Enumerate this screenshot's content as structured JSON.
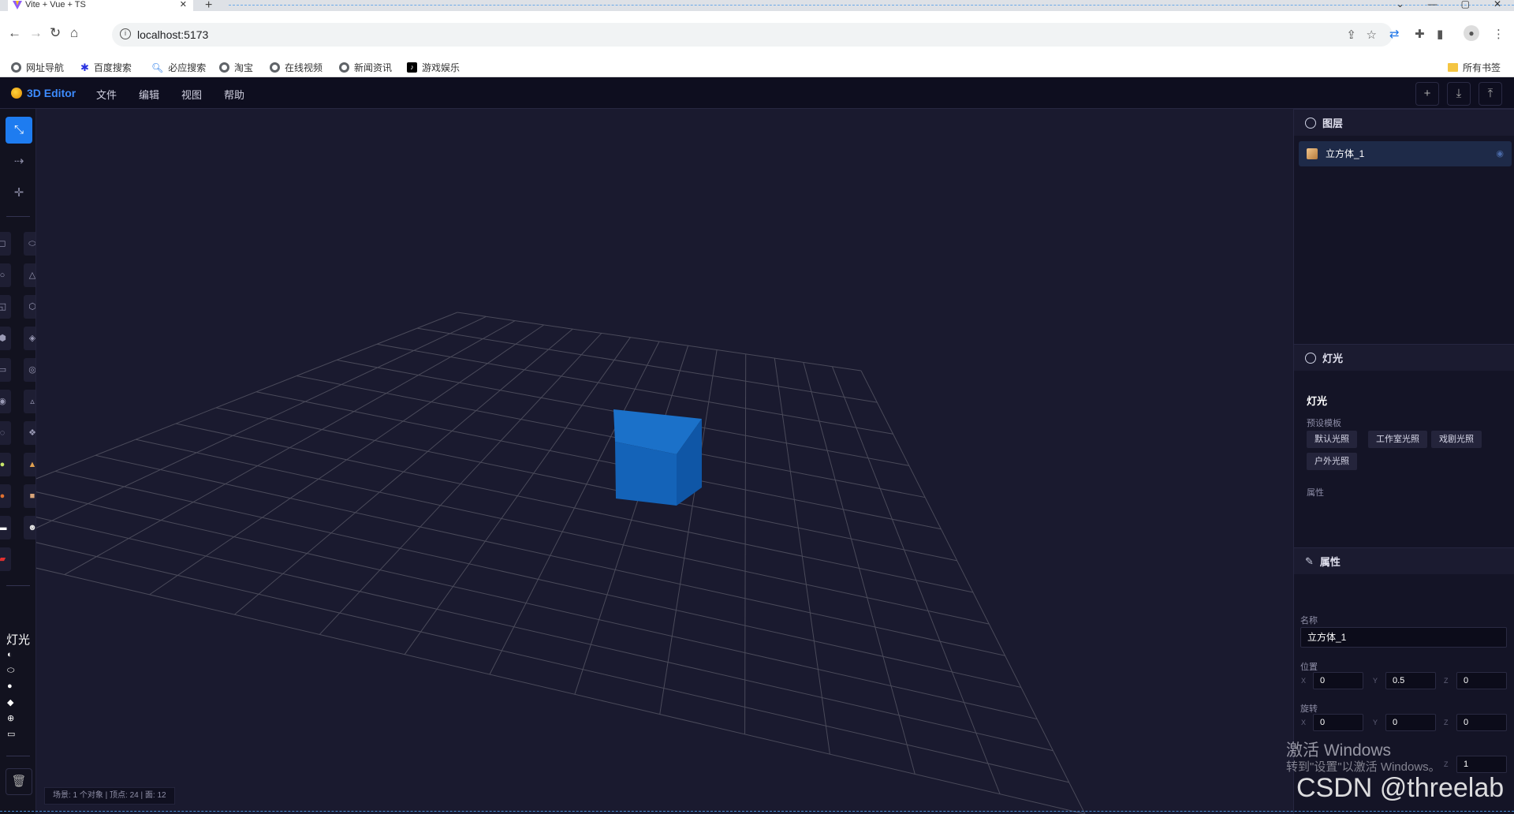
{
  "browser": {
    "tab_title": "Vite + Vue + TS",
    "url": "localhost:5173",
    "bookmarks": [
      "网址导航",
      "百度搜索",
      "必应搜索",
      "淘宝",
      "在线视频",
      "新闻资讯",
      "游戏娱乐"
    ],
    "all_bookmarks": "所有书签"
  },
  "app": {
    "brand": "3D Editor",
    "menus": [
      "文件",
      "编辑",
      "视图",
      "帮助"
    ]
  },
  "left": {
    "light_label": "灯光"
  },
  "layers": {
    "title": "图层",
    "items": [
      {
        "label": "立方体_1"
      }
    ]
  },
  "lights": {
    "header": "灯光",
    "title": "灯光",
    "presets_label": "预设模板",
    "presets": [
      "默认光照",
      "工作室光照",
      "戏剧光照",
      "户外光照"
    ],
    "props_label": "属性"
  },
  "properties": {
    "title": "属性",
    "name_label": "名称",
    "name_value": "立方体_1",
    "position_label": "位置",
    "position": {
      "x": "0",
      "y": "0.5",
      "z": "0"
    },
    "rotation_label": "旋转",
    "rotation": {
      "x": "0",
      "y": "0",
      "z": "0"
    },
    "scale": {
      "z": "1"
    },
    "axis_labels": {
      "x": "X",
      "y": "Y",
      "z": "Z"
    }
  },
  "status": {
    "text": "场景: 1 个对象  |  顶点: 24  |  面: 12"
  },
  "overlay": {
    "activate_title": "激活 Windows",
    "activate_hint": "转到\"设置\"以激活 Windows。",
    "csdn": "CSDN @threelab"
  },
  "colors": {
    "accent": "#1e7cf0",
    "cube": "#1565c0",
    "grid": "#4a4a5a"
  }
}
